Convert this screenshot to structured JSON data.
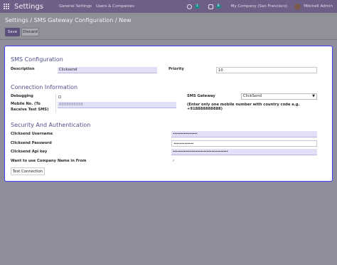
{
  "navbar": {
    "app_title": "Settings",
    "menus": [
      "General Settings",
      "Users & Companies"
    ],
    "activity_count": "1",
    "message_count": "6",
    "company": "My Company (San Francisco)",
    "user": "Mitchell Admin"
  },
  "breadcrumb": "Settings / SMS Gateway Configuration / New",
  "actions": {
    "save": "Save",
    "discard": "Discard"
  },
  "sections": {
    "sms": "SMS Configuration",
    "connection": "Connection Information",
    "security": "Security And Authentication"
  },
  "fields": {
    "description": {
      "label": "Description",
      "value": "Clicksend"
    },
    "priority": {
      "label": "Priority",
      "value": "10"
    },
    "debugging": {
      "label": "Debugging",
      "checked": false
    },
    "sms_gateway": {
      "label": "SMS Gateway",
      "value": "ClickSend"
    },
    "mobile": {
      "label_line1": "Mobile No. (To",
      "label_line2": "Receive Test SMS)",
      "value": "8888888888"
    },
    "mobile_hint": "(Enter only one mobile number with country code e.g. +918888888888)",
    "username": {
      "label": "Clicksend Username",
      "value": "••••••••••••••••"
    },
    "password": {
      "label": "Clicksend Password",
      "value": "•••••••••••••"
    },
    "api_key": {
      "label": "Clicksend Api key",
      "value": "••••••••••••••••••••••••••••••••••••"
    },
    "company_name": {
      "label": "Want to use Company Name in From",
      "checked": true
    }
  },
  "test_button": "Test Connection"
}
